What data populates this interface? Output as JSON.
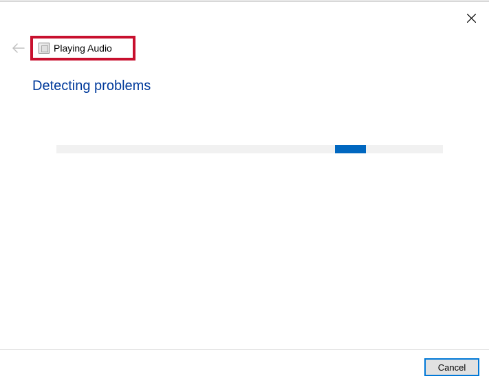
{
  "header": {
    "title": "Playing Audio"
  },
  "main": {
    "status": "Detecting problems",
    "progress": {
      "indeterminate": true,
      "segment_left_pct": 72,
      "segment_width_pct": 8
    }
  },
  "footer": {
    "cancel_label": "Cancel"
  },
  "annotation": {
    "highlight_color": "#c8102e"
  },
  "colors": {
    "heading": "#003a9b",
    "progress_fill": "#0067c0",
    "button_border": "#0078d7"
  }
}
